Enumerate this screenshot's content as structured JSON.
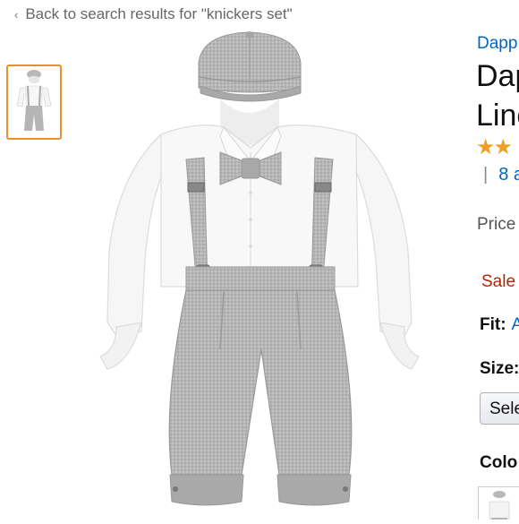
{
  "nav": {
    "back_label": "Back to search results for \"knickers set\""
  },
  "product": {
    "brand": "Dapp",
    "title_line1": "Dap",
    "title_line2": "Line",
    "stars": "★★",
    "rating_fraction": 0.4,
    "reviews_label": "8 a",
    "price_label": "Price",
    "sale_label": "Sale",
    "fit_label": "Fit:",
    "fit_value": "A",
    "size_label": "Size:",
    "size_select_label": "Sele",
    "color_label": "Colo"
  },
  "colors": {
    "accent": "#e8902a",
    "link": "#0066c0",
    "sale": "#b12704",
    "star": "#f0a020"
  },
  "icons": {
    "back": "chevron-left-icon"
  }
}
